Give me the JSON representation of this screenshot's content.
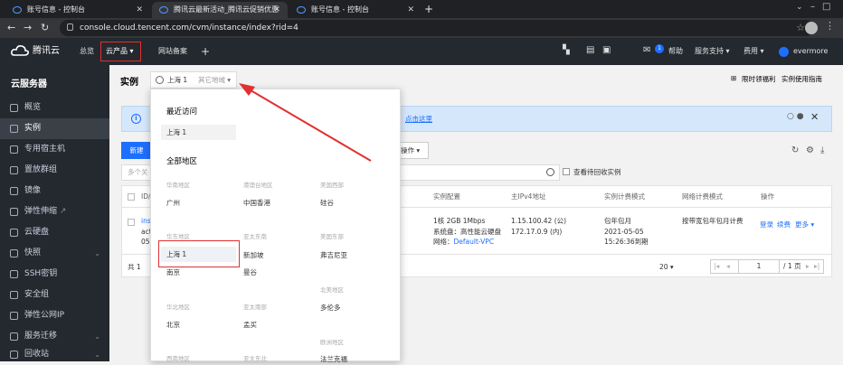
{
  "browser": {
    "tabs": [
      {
        "title": "账号信息 - 控制台",
        "active": false
      },
      {
        "title": "腾讯云最新活动_腾讯云促销优惠",
        "active": true
      },
      {
        "title": "账号信息 - 控制台",
        "active": false
      }
    ],
    "url": "console.cloud.tencent.com/cvm/instance/index?rid=4"
  },
  "header": {
    "brand": "腾讯云",
    "overview": "总览",
    "cloud_products": "云产品",
    "record": "网站备案",
    "notify_count": "1",
    "help": "帮助",
    "support": "服务支持",
    "cost": "费用",
    "user": "evermore"
  },
  "sidebar": {
    "title": "云服务器",
    "items": [
      {
        "label": "概览",
        "icon": "grid-icon"
      },
      {
        "label": "实例",
        "icon": "instance-icon",
        "active": true
      },
      {
        "label": "专用宿主机",
        "icon": "host-icon"
      },
      {
        "label": "置放群组",
        "icon": "placement-icon"
      },
      {
        "label": "镜像",
        "icon": "image-icon"
      },
      {
        "label": "弹性伸缩",
        "icon": "scaling-icon",
        "external": true
      },
      {
        "label": "云硬盘",
        "icon": "disk-icon"
      },
      {
        "label": "快照",
        "icon": "snapshot-icon",
        "expand": true
      },
      {
        "label": "SSH密钥",
        "icon": "key-icon"
      },
      {
        "label": "安全组",
        "icon": "shield-icon"
      },
      {
        "label": "弹性公网IP",
        "icon": "ip-icon"
      },
      {
        "label": "服务迁移",
        "icon": "migrate-icon",
        "expand": true
      },
      {
        "label": "回收站",
        "icon": "trash-icon",
        "expand": true
      }
    ]
  },
  "page": {
    "title": "实例",
    "region_current": "上海 1",
    "region_other": "其它地域",
    "link_free": "限时领福利",
    "link_guide": "实例使用指南",
    "info_link": "点击这里",
    "new_button": "新建",
    "more_ops": "操作",
    "search_placeholder": "多个关",
    "show_recycle": "查看待回收实例",
    "columns": [
      "ID/",
      "实例配置",
      "主IPv4地址",
      "实例计费模式",
      "网络计费模式",
      "操作"
    ],
    "row": {
      "id_short": [
        "ins",
        "act",
        "05"
      ],
      "config": [
        "1核 2GB 1Mbps",
        "系统盘：高性能云硬盘",
        "网络："
      ],
      "vpc": "Default-VPC",
      "ip": [
        "1.15.100.42 (公)",
        "172.17.0.9 (内)"
      ],
      "billing": [
        "包年包月",
        "2021-05-05",
        "15:26:36到期"
      ],
      "net_billing": "按带宽包年包月计费",
      "actions": [
        "登录",
        "续费",
        "更多"
      ]
    },
    "total": "共 1",
    "page_size": "20",
    "page_num": "1",
    "page_total": "/ 1 页"
  },
  "dropdown": {
    "recent_title": "最近访问",
    "recent": "上海 1",
    "all_title": "全部地区",
    "groups": [
      {
        "name": "华南地区",
        "items": [
          "广州"
        ]
      },
      {
        "name": "港澳台地区",
        "items": [
          "中国香港"
        ]
      },
      {
        "name": "美国西部",
        "items": [
          "硅谷"
        ]
      },
      {
        "name": "华东地区",
        "items": [
          "上海 1",
          "南京"
        ]
      },
      {
        "name": "亚太东南",
        "items": [
          "新加坡",
          "曼谷"
        ]
      },
      {
        "name": "美国东部",
        "items": [
          "弗吉尼亚"
        ]
      },
      {
        "name": "北美地区",
        "items": [
          "多伦多"
        ]
      },
      {
        "name": "华北地区",
        "items": [
          "北京"
        ]
      },
      {
        "name": "亚太南部",
        "items": [
          "孟买"
        ]
      },
      {
        "name": "欧洲地区",
        "items": [
          "法兰克福"
        ]
      },
      {
        "name": "西南地区",
        "items": []
      },
      {
        "name": "亚太东北",
        "items": []
      }
    ]
  },
  "colors": {
    "accent": "#1e6fff",
    "highlight": "#e03030",
    "sidebar": "#24292f"
  }
}
